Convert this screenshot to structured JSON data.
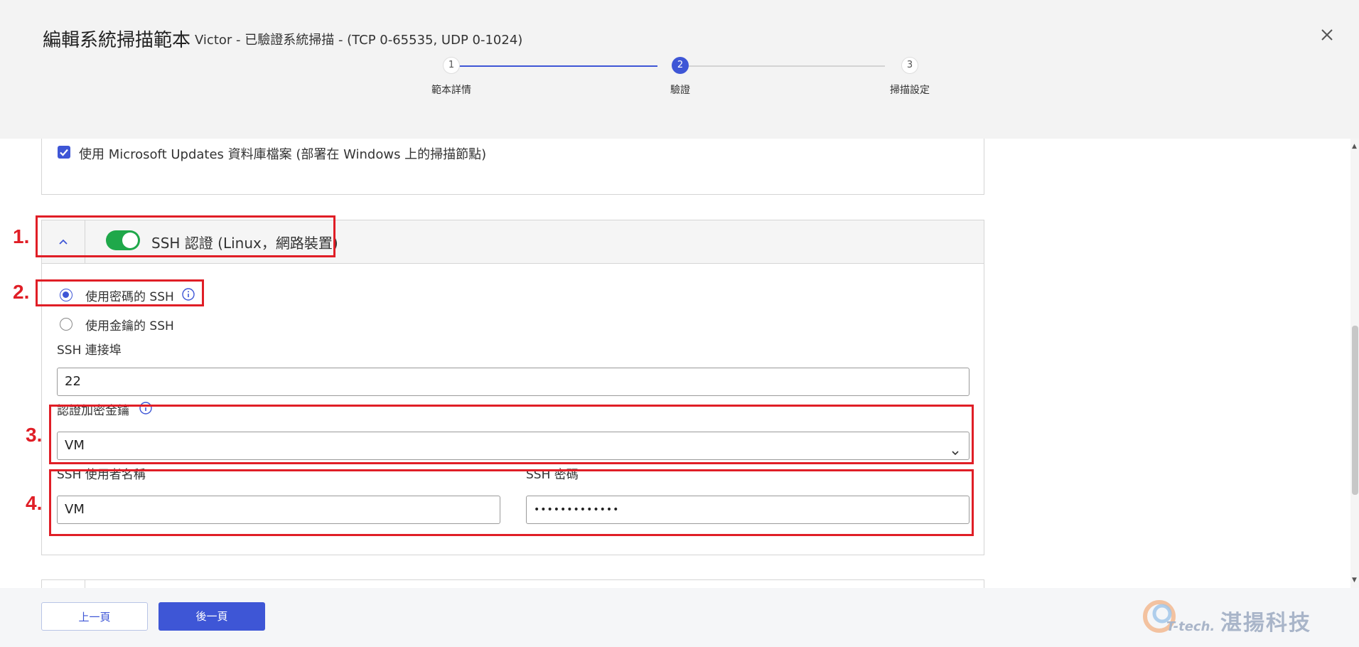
{
  "header": {
    "title": "編輯系統掃描範本",
    "subtitle": "Victor - 已驗證系統掃描 - (TCP 0-65535, UDP 0-1024)"
  },
  "stepper": {
    "steps": [
      {
        "number": "1",
        "label": "範本詳情",
        "state": "done"
      },
      {
        "number": "2",
        "label": "驗證",
        "state": "active"
      },
      {
        "number": "3",
        "label": "掃描設定",
        "state": "todo"
      }
    ]
  },
  "prev_panel": {
    "checkbox_label": "使用 Microsoft Updates 資料庫檔案 (部署在 Windows 上的掃描節點)",
    "checked": true
  },
  "ssh": {
    "title": "SSH 認證 (Linux，網路裝置)",
    "enabled": true,
    "auth_options": [
      {
        "label": "使用密碼的 SSH",
        "selected": true
      },
      {
        "label": "使用金鑰的 SSH",
        "selected": false
      }
    ],
    "port_label": "SSH 連接埠",
    "port_value": "22",
    "key_label": "認證加密金鑰",
    "key_value": "VM",
    "username_label": "SSH 使用者名稱",
    "username_value": "VM",
    "password_label": "SSH 密碼",
    "password_value": "•••••••••••••"
  },
  "annotations": [
    "1.",
    "2.",
    "3.",
    "4."
  ],
  "footer": {
    "prev_label": "上一頁",
    "next_label": "後一頁"
  },
  "logo": {
    "sub": "T-tech.",
    "text": "湛揚科技"
  },
  "colors": {
    "accent": "#3e56d6",
    "toggle_on": "#1fa84a",
    "annotation": "#e01e26"
  }
}
